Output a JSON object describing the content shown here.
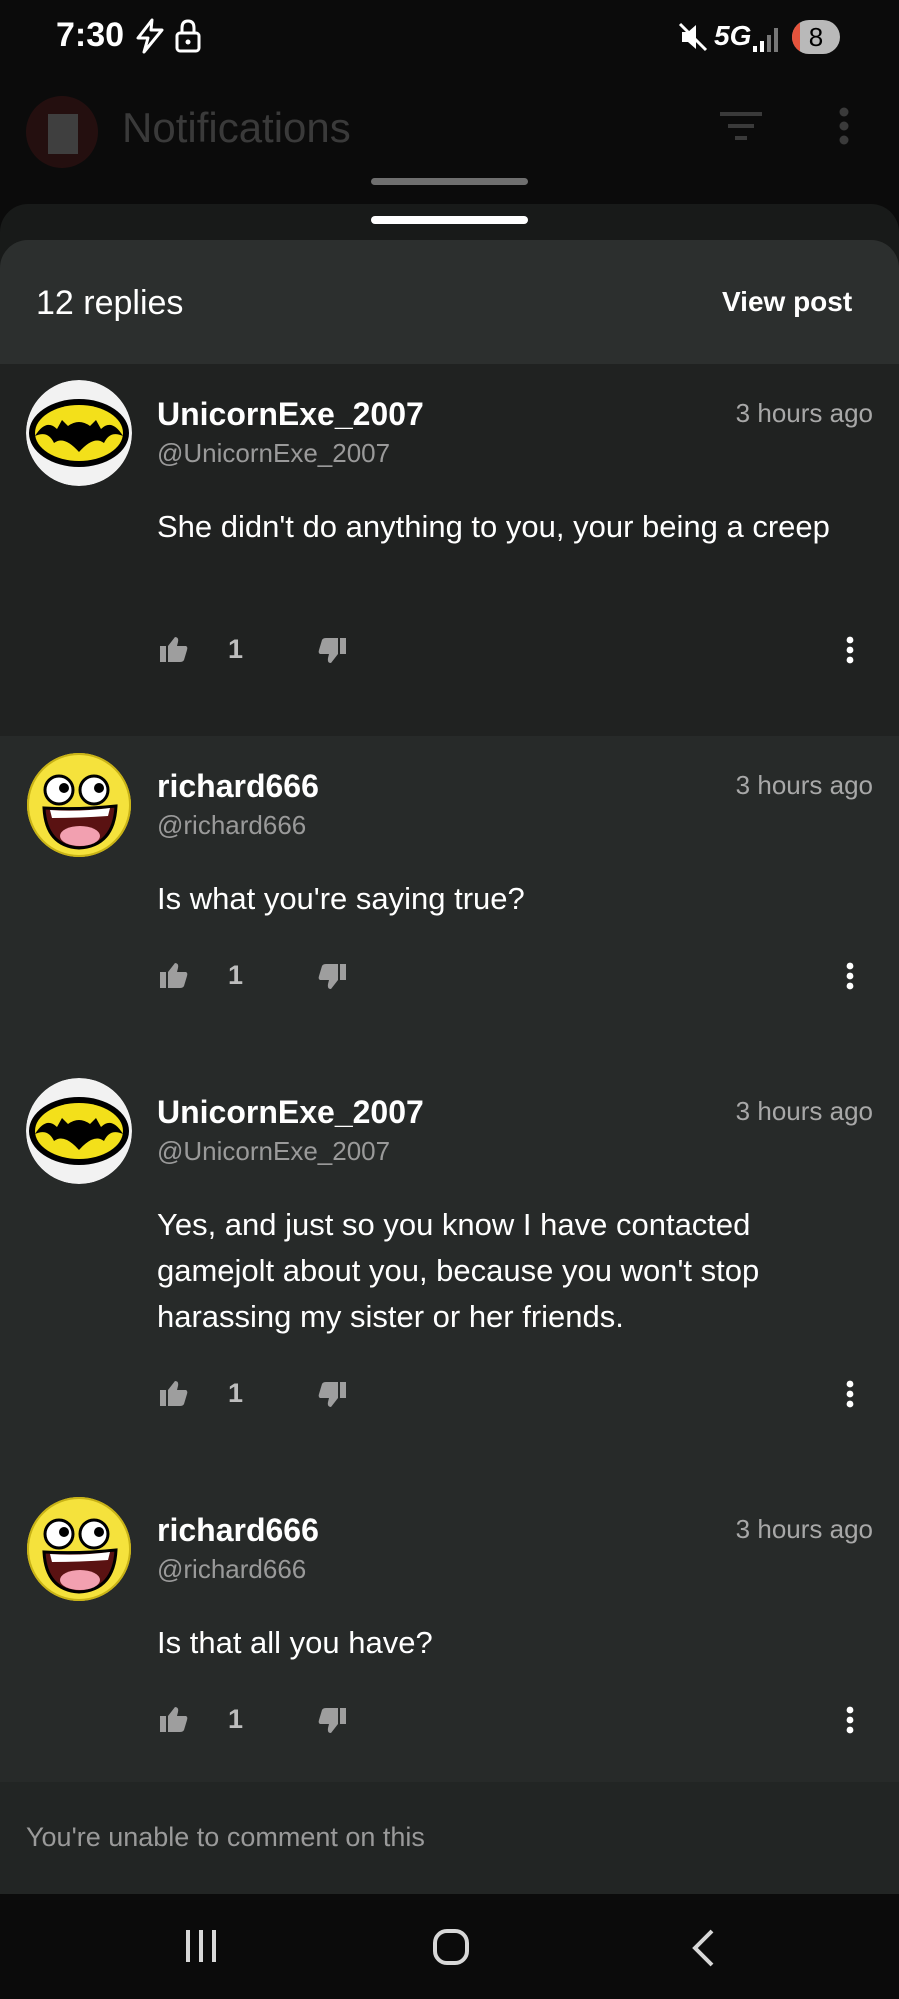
{
  "status_bar": {
    "time": "7:30",
    "network": "5G",
    "battery": "8"
  },
  "app_bar": {
    "title": "Notifications"
  },
  "sheet": {
    "replies_label": "12 replies",
    "view_post_label": "View post"
  },
  "comments": [
    {
      "username": "UnicornExe_2007",
      "handle": "@UnicornExe_2007",
      "time": "3 hours ago",
      "text": "She didn't do anything to you, your being a creep",
      "likes": "1",
      "avatar": "batman-icon"
    },
    {
      "username": "richard666",
      "handle": "@richard666",
      "time": "3 hours ago",
      "text": "Is what you're saying true?",
      "likes": "1",
      "avatar": "awesome-face-icon"
    },
    {
      "username": "UnicornExe_2007",
      "handle": "@UnicornExe_2007",
      "time": "3 hours ago",
      "text": "Yes, and just so you know I have contacted gamejolt about you, because you won't stop harassing my sister or her friends.",
      "likes": "1",
      "avatar": "batman-icon"
    },
    {
      "username": "richard666",
      "handle": "@richard666",
      "time": "3 hours ago",
      "text": "Is that all you have?",
      "likes": "1",
      "avatar": "awesome-face-icon"
    }
  ],
  "footer": {
    "notice": "You're unable to comment on this"
  },
  "colors": {
    "sheet_bg": "#202221",
    "header_bg": "#2c2f2e",
    "text": "#ffffff",
    "muted": "#9a9a9a"
  }
}
